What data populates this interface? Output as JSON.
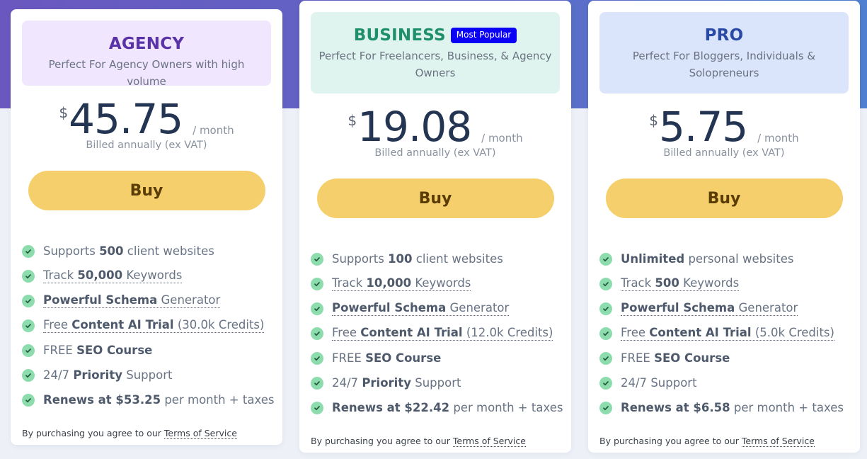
{
  "theme": {
    "accent_buy": "#f6cf6d",
    "badge": "#0a00f5",
    "check": "#8ddcae"
  },
  "plans": [
    {
      "id": "agency",
      "name": "AGENCY",
      "description": "Perfect For Agency Owners with high volume",
      "currency": "$",
      "price": "45.75",
      "period": "/ month",
      "billing": "Billed annually (ex VAT)",
      "buy_label": "Buy",
      "features": [
        {
          "pre": "Supports ",
          "bold": "500",
          "post": " client websites",
          "dotted": false
        },
        {
          "pre": "Track ",
          "bold": "50,000",
          "post": " Keywords",
          "dotted": true
        },
        {
          "pre": "",
          "bold": "Powerful Schema",
          "post": " Generator",
          "dotted": true
        },
        {
          "pre": "Free ",
          "bold": "Content AI Trial",
          "post": " (30.0k Credits)",
          "dotted": true
        },
        {
          "pre": "FREE ",
          "bold": "SEO Course",
          "post": "",
          "dotted": false
        },
        {
          "pre": "24/7 ",
          "bold": "Priority",
          "post": " Support",
          "dotted": false
        },
        {
          "pre": "",
          "bold": "Renews at $53.25",
          "post": " per month + taxes",
          "dotted": false
        }
      ],
      "terms_text": "By purchasing you agree to our ",
      "terms_link": "Terms of Service"
    },
    {
      "id": "business",
      "name": "BUSINESS",
      "badge": "Most Popular",
      "description": "Perfect For Freelancers, Business, & Agency Owners",
      "currency": "$",
      "price": "19.08",
      "period": "/ month",
      "billing": "Billed annually (ex VAT)",
      "buy_label": "Buy",
      "features": [
        {
          "pre": "Supports ",
          "bold": "100",
          "post": " client websites",
          "dotted": false
        },
        {
          "pre": "Track ",
          "bold": "10,000",
          "post": " Keywords",
          "dotted": true
        },
        {
          "pre": "",
          "bold": "Powerful Schema",
          "post": " Generator",
          "dotted": true
        },
        {
          "pre": "Free ",
          "bold": "Content AI Trial",
          "post": " (12.0k Credits)",
          "dotted": true
        },
        {
          "pre": "FREE ",
          "bold": "SEO Course",
          "post": "",
          "dotted": false
        },
        {
          "pre": "24/7 ",
          "bold": "Priority",
          "post": " Support",
          "dotted": false
        },
        {
          "pre": "",
          "bold": "Renews at $22.42",
          "post": " per month + taxes",
          "dotted": false
        }
      ],
      "terms_text": "By purchasing you agree to our ",
      "terms_link": "Terms of Service"
    },
    {
      "id": "pro",
      "name": "PRO",
      "description": "Perfect For Bloggers, Individuals & Solopreneurs",
      "currency": "$",
      "price": "5.75",
      "period": "/ month",
      "billing": "Billed annually (ex VAT)",
      "buy_label": "Buy",
      "features": [
        {
          "pre": "",
          "bold": "Unlimited",
          "post": " personal websites",
          "dotted": false
        },
        {
          "pre": "Track ",
          "bold": "500",
          "post": " Keywords",
          "dotted": true
        },
        {
          "pre": "",
          "bold": "Powerful Schema",
          "post": " Generator",
          "dotted": true
        },
        {
          "pre": "Free ",
          "bold": "Content AI Trial",
          "post": " (5.0k Credits)",
          "dotted": true
        },
        {
          "pre": "FREE ",
          "bold": "SEO Course",
          "post": "",
          "dotted": false
        },
        {
          "pre": "24/7 ",
          "bold": "",
          "post": "Support",
          "dotted": false
        },
        {
          "pre": "",
          "bold": "Renews at $6.58",
          "post": " per month + taxes",
          "dotted": false
        }
      ],
      "terms_text": "By purchasing you agree to our ",
      "terms_link": "Terms of Service"
    }
  ]
}
